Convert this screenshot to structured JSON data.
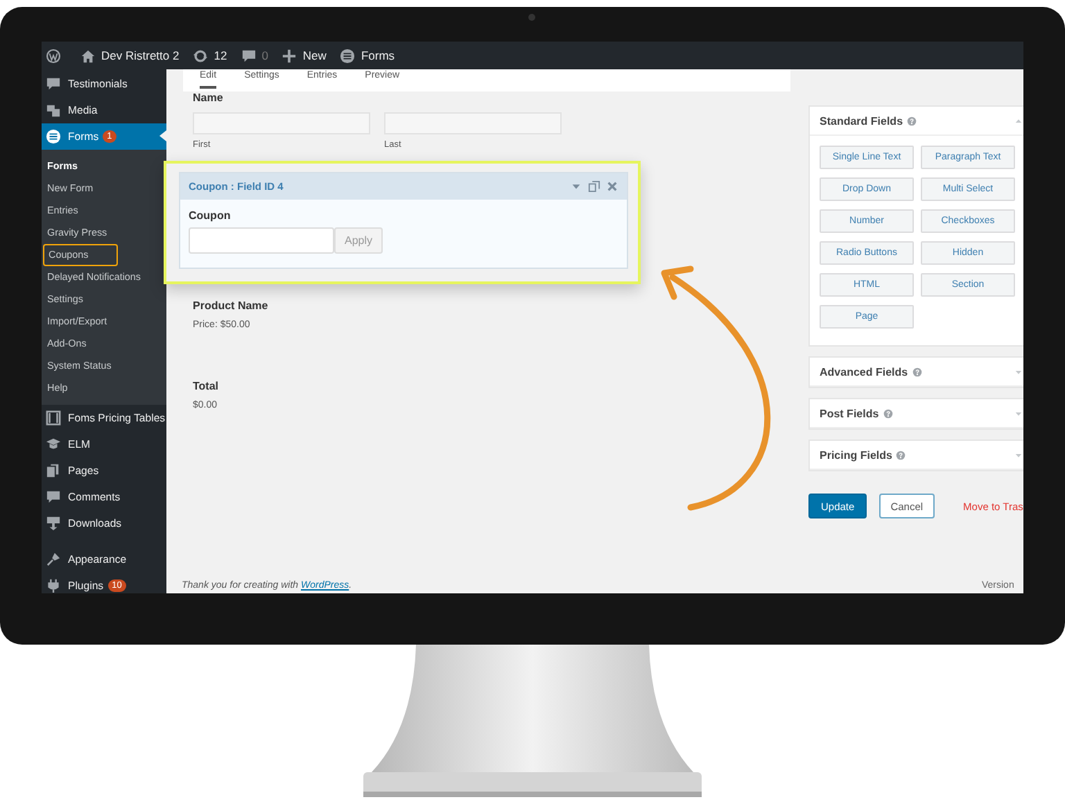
{
  "admin_bar": {
    "site": "Dev Ristretto 2",
    "updates": "12",
    "comments": "0",
    "new": "New",
    "forms": "Forms"
  },
  "sidebar": {
    "items": [
      {
        "label": "Testimonials",
        "selected": false
      },
      {
        "label": "Media",
        "selected": false
      },
      {
        "label": "Forms",
        "selected": true,
        "badge": "1",
        "children": [
          {
            "label": "Forms",
            "selected": true,
            "highlighted": false
          },
          {
            "label": "New Form",
            "selected": false,
            "highlighted": false
          },
          {
            "label": "Entries",
            "selected": false,
            "highlighted": false
          },
          {
            "label": "Gravity Press",
            "selected": false,
            "highlighted": false
          },
          {
            "label": "Coupons",
            "selected": false,
            "highlighted": true
          },
          {
            "label": "Delayed Notifications",
            "selected": false,
            "highlighted": false
          },
          {
            "label": "Settings",
            "selected": false,
            "highlighted": false
          },
          {
            "label": "Import/Export",
            "selected": false,
            "highlighted": false
          },
          {
            "label": "Add-Ons",
            "selected": false,
            "highlighted": false
          },
          {
            "label": "System Status",
            "selected": false,
            "highlighted": false
          },
          {
            "label": "Help",
            "selected": false,
            "highlighted": false
          }
        ]
      },
      {
        "label": "Foms Pricing Tables",
        "selected": false
      },
      {
        "label": "ELM",
        "selected": false
      },
      {
        "label": "Pages",
        "selected": false
      },
      {
        "label": "Comments",
        "selected": false
      },
      {
        "label": "Downloads",
        "selected": false
      },
      {
        "label": "Appearance",
        "selected": false
      },
      {
        "label": "Plugins",
        "selected": false,
        "badge": "10"
      }
    ]
  },
  "tabs": [
    {
      "label": "Edit",
      "selected": true
    },
    {
      "label": "Settings",
      "selected": false
    },
    {
      "label": "Entries",
      "selected": false
    },
    {
      "label": "Preview",
      "selected": false
    }
  ],
  "form": {
    "fields": [
      {
        "kind": "name",
        "label": "Name",
        "sublabels": [
          "First",
          "Last"
        ]
      },
      {
        "kind": "coupon",
        "header": "Coupon : Field ID 4",
        "label": "Coupon",
        "button": "Apply",
        "selected": true
      },
      {
        "kind": "product",
        "label": "Product Name",
        "price": "Price: $50.00"
      },
      {
        "kind": "total",
        "label": "Total",
        "value": "$0.00"
      }
    ]
  },
  "field_groups": [
    {
      "title": "Standard Fields",
      "expanded": true,
      "buttons": [
        "Single Line Text",
        "Paragraph Text",
        "Drop Down",
        "Multi Select",
        "Number",
        "Checkboxes",
        "Radio Buttons",
        "Hidden",
        "HTML",
        "Section",
        "Page"
      ]
    },
    {
      "title": "Advanced Fields",
      "expanded": false
    },
    {
      "title": "Post Fields",
      "expanded": false
    },
    {
      "title": "Pricing Fields",
      "expanded": false
    }
  ],
  "actions": {
    "update": "Update",
    "cancel": "Cancel",
    "trash": "Move to Tras"
  },
  "footer": {
    "text": "Thank you for creating with ",
    "link": "WordPress",
    "end": ".",
    "version": "Version"
  }
}
